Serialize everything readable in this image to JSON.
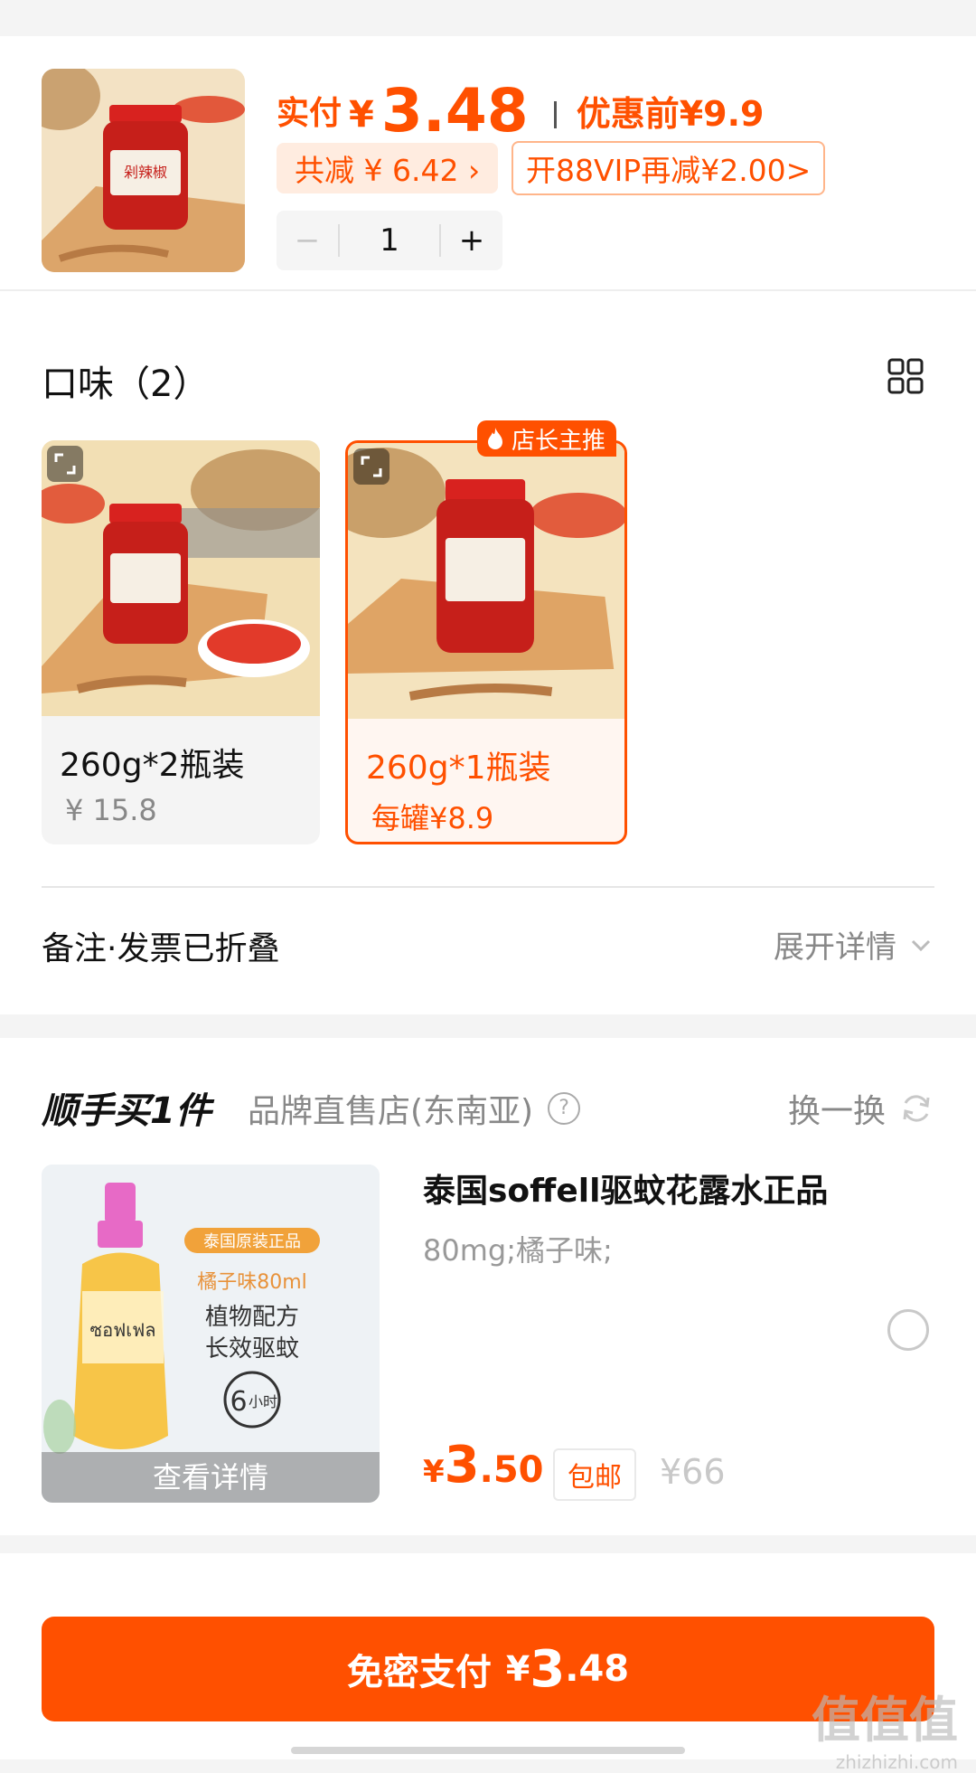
{
  "product": {
    "pay_label": "实付",
    "pay_yen": "¥",
    "pay_amount": "3.48",
    "before_label": "优惠前¥9.9",
    "reduce_chip": "共减 ¥ 6.42 ›",
    "vip_chip": "开88VIP再减¥2.00>",
    "quantity": "1",
    "minus": "−",
    "plus": "+"
  },
  "flavor": {
    "title": "口味（2）",
    "options": [
      {
        "name": "260g*2瓶装",
        "price": "¥ 15.8",
        "selected": false
      },
      {
        "name": "260g*1瓶装",
        "price": "每罐¥8.9",
        "selected": true
      }
    ],
    "recommend_badge": "店长主推",
    "jar_brand": "剁辣椒"
  },
  "notes": {
    "label": "备注·发票已折叠",
    "expand": "展开详情"
  },
  "addon": {
    "title": "顺手买1件",
    "store": "品牌直售店(东南亚)",
    "help": "?",
    "swap": "换一换",
    "name": "泰国soffell驱蚊花露水正品",
    "spec": "80mg;橘子味;",
    "price_yen": "¥",
    "price_int": "3",
    "price_dec": ".50",
    "free_ship": "包邮",
    "orig_price": "¥66",
    "view_detail": "查看详情",
    "img_tag": "泰国原装正品",
    "img_line1": "橘子味80ml",
    "img_line2": "植物配方",
    "img_line3": "长效驱蚊",
    "img_hours_num": "6",
    "img_hours_unit": "小时",
    "img_bottle_text": "ซอฟเฟล"
  },
  "pay": {
    "label": "免密支付",
    "yen": "¥",
    "int": "3",
    "dec": ".48"
  },
  "watermark": {
    "main": "值值值",
    "sub": "zhizhizhi.com"
  },
  "colors": {
    "accent": "#ff5000",
    "accent_light": "#ffece0",
    "muted": "#888888",
    "background": "#f4f4f4"
  }
}
